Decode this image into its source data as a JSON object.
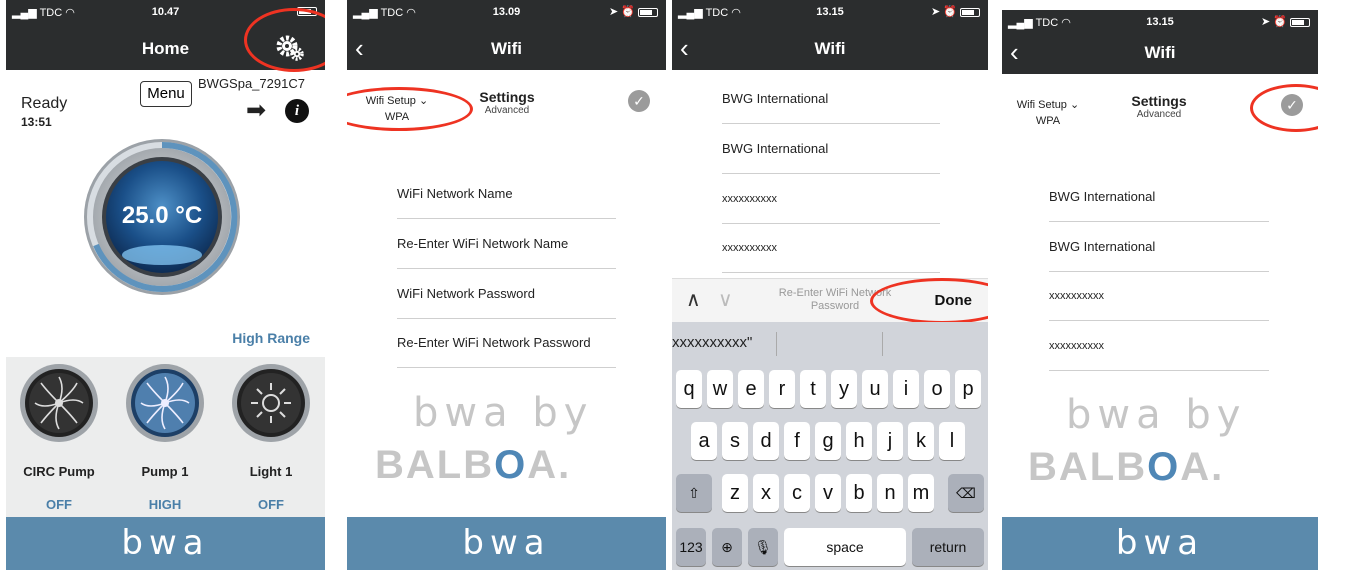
{
  "screen1": {
    "status": {
      "carrier": "TDC",
      "time": "10.47"
    },
    "title": "Home",
    "ready": "Ready",
    "ready_time": "13:51",
    "menu": "Menu",
    "device": "BWGSpa_7291C7",
    "temperature": "25.0 °C",
    "range": "High Range",
    "controls": [
      {
        "label": "CIRC Pump",
        "state": "OFF"
      },
      {
        "label": "Pump 1",
        "state": "HIGH"
      },
      {
        "label": "Light 1",
        "state": "OFF"
      }
    ],
    "footer": "bwa",
    "icons": [
      "gear-icon",
      "arrow-right-icon",
      "info-icon"
    ]
  },
  "screen2": {
    "status": {
      "carrier": "TDC",
      "time": "13.09"
    },
    "title": "Wifi",
    "tab_left": {
      "line1": "Wifi Setup ⌄",
      "line2": "WPA"
    },
    "tab_right": {
      "line1": "Settings",
      "line2": "Advanced"
    },
    "fields": [
      "WiFi Network Name",
      "Re-Enter WiFi Network Name",
      "WiFi Network Password",
      "Re-Enter WiFi Network Password"
    ],
    "brand_top": "bwa by",
    "brand_bottom_left": "BALB",
    "brand_o": "O",
    "brand_bottom_right": "A.",
    "footer": "bwa"
  },
  "screen3": {
    "status": {
      "carrier": "TDC",
      "time": "13.15"
    },
    "title": "Wifi",
    "fields": [
      "BWG International",
      "BWG International",
      "xxxxxxxxxx",
      "xxxxxxxxxx"
    ],
    "kb_hint": "Re-Enter WiFi Network Password",
    "done": "Done",
    "suggestion": "xxxxxxxxxx\"",
    "rows": [
      [
        "q",
        "w",
        "e",
        "r",
        "t",
        "y",
        "u",
        "i",
        "o",
        "p"
      ],
      [
        "a",
        "s",
        "d",
        "f",
        "g",
        "h",
        "j",
        "k",
        "l"
      ],
      [
        "z",
        "x",
        "c",
        "v",
        "b",
        "n",
        "m"
      ]
    ],
    "key_123": "123",
    "key_space": "space",
    "key_return": "return"
  },
  "screen4": {
    "status": {
      "carrier": "TDC",
      "time": "13.15"
    },
    "title": "Wifi",
    "tab_left": {
      "line1": "Wifi Setup ⌄",
      "line2": "WPA"
    },
    "tab_right": {
      "line1": "Settings",
      "line2": "Advanced"
    },
    "fields": [
      "BWG International",
      "BWG International",
      "xxxxxxxxxx",
      "xxxxxxxxxx"
    ],
    "brand_top": "bwa by",
    "brand_bottom_left": "BALB",
    "brand_o": "O",
    "brand_bottom_right": "A.",
    "footer": "bwa"
  },
  "colors": {
    "bar": "#2b2d2e",
    "accent": "#4a7fa8",
    "footer": "#5b8aac",
    "highlight": "#e32222"
  }
}
